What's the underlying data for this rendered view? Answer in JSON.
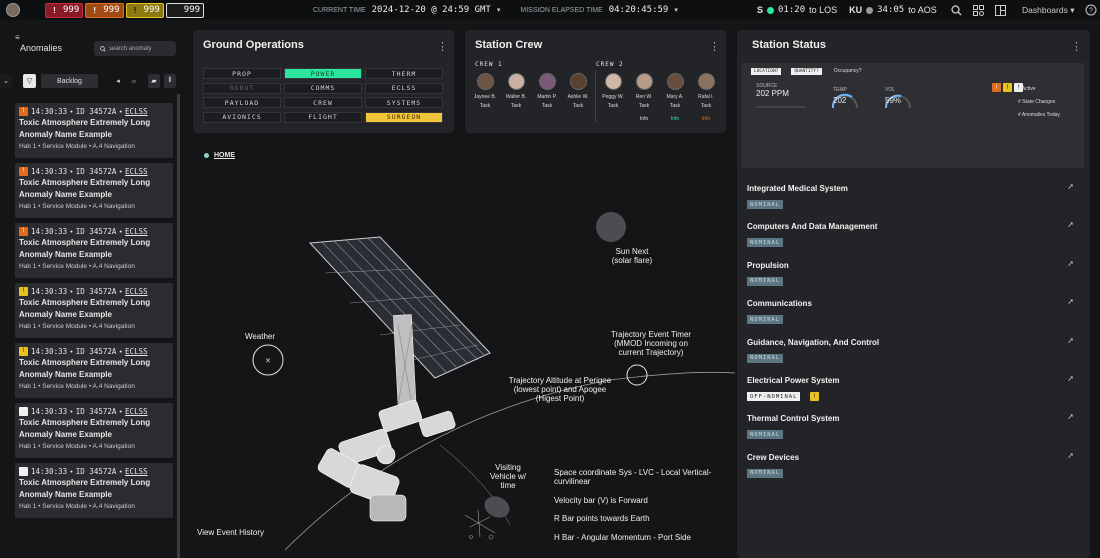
{
  "topbar": {
    "alarms": [
      {
        "symbol": "!",
        "count": "999",
        "color": "#c62c3a"
      },
      {
        "symbol": "!",
        "count": "999",
        "color": "#e06d1e"
      },
      {
        "symbol": "!",
        "count": "999",
        "color": "#e6c322"
      },
      {
        "symbol": "",
        "count": "999",
        "color": "#dddddd"
      }
    ],
    "current_time_label": "CURRENT TIME",
    "current_time": "2024-12-20 @ 24:59 GMT",
    "met_label": "MISSION ELAPSED TIME",
    "met": "04:20:45:59",
    "los": {
      "band": "S",
      "time": "01:20",
      "to": "to LOS",
      "color": "#2ce6a0"
    },
    "aos": {
      "band": "KU",
      "time": "34:05",
      "to": "to AOS",
      "color": "#9a9a9a"
    },
    "dashboards_label": "Dashboards"
  },
  "anomalies": {
    "title": "Anomalies",
    "search_placeholder": "search anomaly",
    "backlog_label": "Backlog",
    "items": [
      {
        "sev_color": "#e06d1e",
        "sev_symbol": "!",
        "time": "14:30:33",
        "id": "ID 34572A",
        "system": "ECLSS",
        "name": "Toxic Atmosphere Extremely Long Anomaly Name Example",
        "location": "Hab 1 • Service Module • A.4 Navigation"
      },
      {
        "sev_color": "#e06d1e",
        "sev_symbol": "!",
        "time": "14:30:33",
        "id": "ID 34572A",
        "system": "ECLSS",
        "name": "Toxic Atmosphere Extremely Long Anomaly Name Example",
        "location": "Hab 1 • Service Module • A.4 Navigation"
      },
      {
        "sev_color": "#e06d1e",
        "sev_symbol": "!",
        "time": "14:30:33",
        "id": "ID 34572A",
        "system": "ECLSS",
        "name": "Toxic Atmosphere Extremely Long Anomaly Name Example",
        "location": "Hab 1 • Service Module • A.4 Navigation"
      },
      {
        "sev_color": "#e6c322",
        "sev_symbol": "!",
        "time": "14:30:33",
        "id": "ID 34572A",
        "system": "ECLSS",
        "name": "Toxic Atmosphere Extremely Long Anomaly Name Example",
        "location": "Hab 1 • Service Module • A.4 Navigation"
      },
      {
        "sev_color": "#e6c322",
        "sev_symbol": "!",
        "time": "14:30:33",
        "id": "ID 34572A",
        "system": "ECLSS",
        "name": "Toxic Atmosphere Extremely Long Anomaly Name Example",
        "location": "Hab 1 • Service Module • A.4 Navigation"
      },
      {
        "sev_color": "#f0f0f0",
        "sev_symbol": "",
        "time": "14:30:33",
        "id": "ID 34572A",
        "system": "ECLSS",
        "name": "Toxic Atmosphere Extremely Long Anomaly Name Example",
        "location": "Hab 1 • Service Module • A.4 Navigation"
      },
      {
        "sev_color": "#f0f0f0",
        "sev_symbol": "",
        "time": "14:30:33",
        "id": "ID 34572A",
        "system": "ECLSS",
        "name": "Toxic Atmosphere Extremely Long Anomaly Name Example",
        "location": "Hab 1 • Service Module • A.4 Navigation"
      }
    ]
  },
  "ground_ops": {
    "title": "Ground Operations",
    "cells": [
      {
        "label": "PROP",
        "state": "normal"
      },
      {
        "label": "POWER",
        "state": "green"
      },
      {
        "label": "THERM",
        "state": "normal"
      },
      {
        "label": "ROBOT",
        "state": "dim"
      },
      {
        "label": "COMMS",
        "state": "normal"
      },
      {
        "label": "ECLSS",
        "state": "normal"
      },
      {
        "label": "PAYLOAD",
        "state": "normal"
      },
      {
        "label": "CREW",
        "state": "normal"
      },
      {
        "label": "SYSTEMS",
        "state": "normal"
      },
      {
        "label": "AVIONICS",
        "state": "normal"
      },
      {
        "label": "FLIGHT",
        "state": "normal"
      },
      {
        "label": "SURGEON",
        "state": "yellow"
      }
    ]
  },
  "station_crew": {
    "title": "Station Crew",
    "crew1_label": "CREW 1",
    "crew2_label": "CREW 2",
    "crew1": [
      {
        "name": "Jaynee B.",
        "task": "Task",
        "info": ""
      },
      {
        "name": "Walter B.",
        "task": "Task",
        "info": ""
      },
      {
        "name": "Martin P.",
        "task": "Task",
        "info": ""
      },
      {
        "name": "Ashlie W.",
        "task": "Task",
        "info": ""
      }
    ],
    "crew2": [
      {
        "name": "Peggy W.",
        "task": "Task",
        "info": ""
      },
      {
        "name": "Ren W.",
        "task": "Task",
        "info": "Info",
        "color": "#dddddd"
      },
      {
        "name": "Mary A.",
        "task": "Task",
        "info": "Info",
        "color": "#2ce6a0"
      },
      {
        "name": "Rafal I.",
        "task": "Task",
        "info": "Info",
        "color": "#e06d1e"
      }
    ]
  },
  "map": {
    "home_label": "HOME",
    "sun_label": "Sun Next (solar flare)",
    "weather_label": "Weather",
    "trajectory_timer_label": "Trajectory Event Timer (MMOD Incoming on current Trajectory)",
    "trajectory_label": "Trajectory Altitude at Perigee (lowest point) and Apogee (Higest Point)",
    "visiting_label": "Visiting Vehicle w/ time",
    "coord_label": "Space coordinate Sys - LVC - Local Vertical- curvilinear",
    "velocity_label": "Velocity bar (V) is Forward",
    "rbar_label": "R Bar points towards Earth",
    "hbar_label": "H Bar - Angular Momentum - Port Side",
    "history_label": "View Event History"
  },
  "station_status": {
    "title": "Station Status",
    "chips": [
      "LOCATION?",
      "QUANTITY?"
    ],
    "occupancy_label": "Occupancy?",
    "source_label": "SOURCE",
    "ppm_value": "202 PPM",
    "temp_label": "TEMP",
    "temp_value": "202",
    "humidity_label": "VOL",
    "humidity_value": "59%",
    "legend": [
      "# Active",
      "# State Changes",
      "# Anomalies Today"
    ],
    "systems": [
      {
        "name": "Integrated Medical System",
        "status": "NOMINAL",
        "warn": false
      },
      {
        "name": "Computers And Data Management",
        "status": "NOMINAL",
        "warn": false
      },
      {
        "name": "Propulsion",
        "status": "NOMINAL",
        "warn": false
      },
      {
        "name": "Communications",
        "status": "NOMINAL",
        "warn": false
      },
      {
        "name": "Guidance, Navigation, And Control",
        "status": "NOMINAL",
        "warn": false
      },
      {
        "name": "Electrical Power System",
        "status": "OFF-NOMINAL",
        "warn": true
      },
      {
        "name": "Thermal Control System",
        "status": "NOMINAL",
        "warn": false
      },
      {
        "name": "Crew Devices",
        "status": "NOMINAL",
        "warn": false
      }
    ]
  }
}
